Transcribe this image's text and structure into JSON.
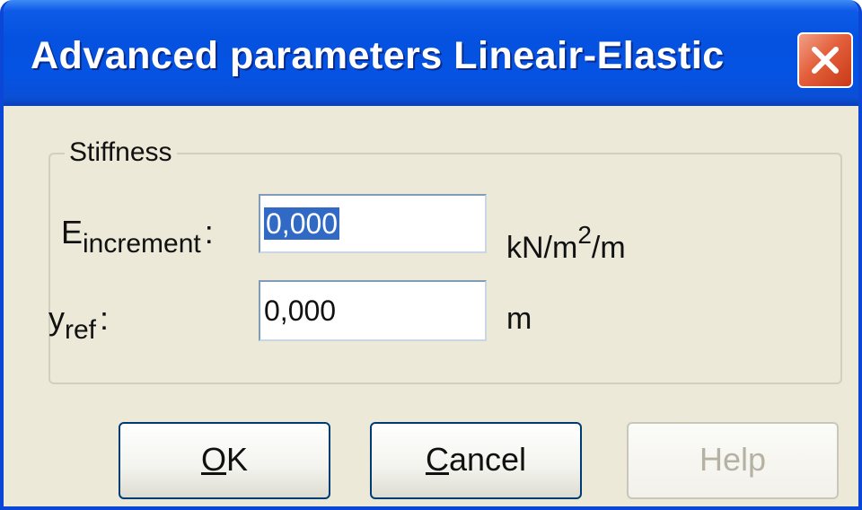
{
  "window": {
    "title": "Advanced parameters Lineair-Elastic",
    "close_icon": "close-icon"
  },
  "stiffness": {
    "group_label": "Stiffness",
    "e_increment": {
      "symbol": "E",
      "subscript": "increment",
      "colon": ":",
      "value": "0,000",
      "unit_prefix": "kN/m",
      "unit_exponent": "2",
      "unit_suffix": "/m"
    },
    "y_ref": {
      "symbol": "y",
      "subscript": "ref",
      "colon": ":",
      "value": "0,000",
      "unit": "m"
    }
  },
  "buttons": {
    "ok": {
      "mnemonic": "O",
      "rest": "K"
    },
    "cancel": {
      "mnemonic": "C",
      "rest": "ancel"
    },
    "help": {
      "label": "Help",
      "enabled": false
    }
  },
  "colors": {
    "titlebar": "#0552e0",
    "dialog_bg": "#ece9d8",
    "close_button": "#e4603c",
    "selection": "#316ac5"
  }
}
